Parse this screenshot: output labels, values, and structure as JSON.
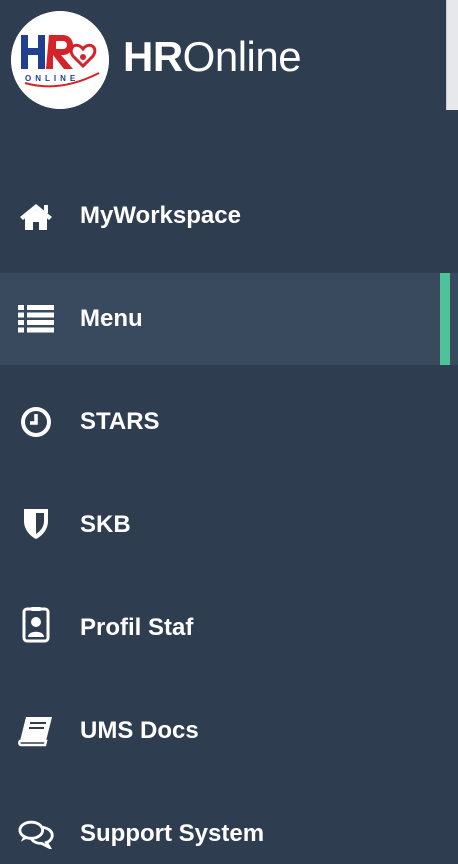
{
  "brand": {
    "logo_text_main": "HR",
    "logo_text_sub": "ONLINE",
    "name_bold": "HR",
    "name_light": "Online"
  },
  "menu": {
    "items": [
      {
        "label": "MyWorkspace",
        "icon": "home-icon",
        "active": false
      },
      {
        "label": "Menu",
        "icon": "list-icon",
        "active": true
      },
      {
        "label": "STARS",
        "icon": "clock-icon",
        "active": false
      },
      {
        "label": "SKB",
        "icon": "shield-icon",
        "active": false
      },
      {
        "label": "Profil Staf",
        "icon": "id-badge-icon",
        "active": false
      },
      {
        "label": "UMS Docs",
        "icon": "book-icon",
        "active": false
      },
      {
        "label": "Support System",
        "icon": "comments-icon",
        "active": false
      }
    ]
  },
  "colors": {
    "sidebar_bg": "#2e3e50",
    "active_bg": "#3a4a5e",
    "active_accent": "#4ec39a",
    "text": "#ffffff",
    "logo_red": "#d6232a",
    "logo_blue": "#1f3f8f"
  }
}
